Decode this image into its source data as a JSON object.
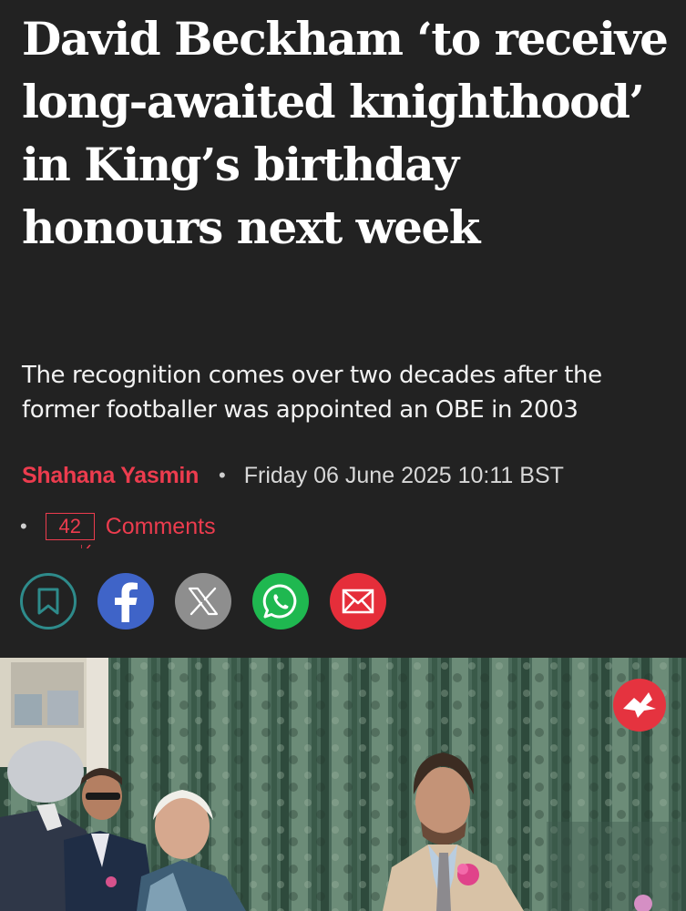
{
  "article": {
    "headline": "David Beckham ‘to receive long-awaited knighthood’ in King’s birthday honours next week",
    "standfirst": "The recognition comes over two decades after the former footballer was appointed an OBE in 2003",
    "author": "Shahana Yasmin",
    "separator": "•",
    "date": "Friday 06 June 2025 10:11 BST",
    "comment_count": "42",
    "comments_label": "Comments"
  },
  "share": {
    "buttons": [
      {
        "name": "bookmark",
        "icon": "bookmark-icon",
        "color": "#2e8b8b"
      },
      {
        "name": "facebook",
        "icon": "facebook-icon",
        "color": "#3f64c8"
      },
      {
        "name": "x",
        "icon": "x-icon",
        "color": "#8e8e8e"
      },
      {
        "name": "whatsapp",
        "icon": "whatsapp-icon",
        "color": "#1fb850"
      },
      {
        "name": "email",
        "icon": "email-icon",
        "color": "#e52e3a"
      }
    ]
  },
  "photo": {
    "logo_icon": "eagle-logo-icon"
  },
  "colors": {
    "background": "#222222",
    "accent": "#ec3c4e",
    "headline": "#ffffff"
  }
}
